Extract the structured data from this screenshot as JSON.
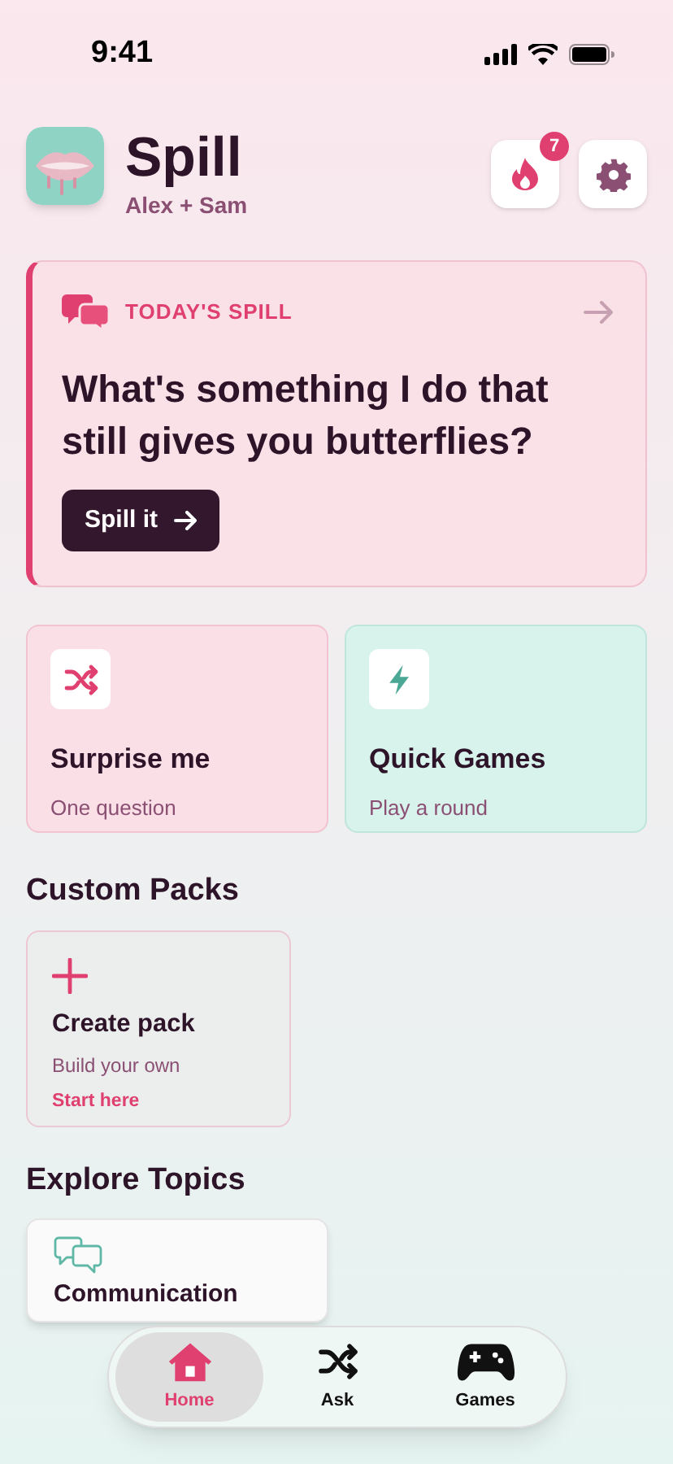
{
  "status_bar": {
    "time": "9:41"
  },
  "header": {
    "title": "Spill",
    "subtitle": "Alex + Sam",
    "streak_count": "7"
  },
  "todays_spill": {
    "label": "TODAY'S SPILL",
    "question": "What's something I do that still gives you butterflies?",
    "button": "Spill it"
  },
  "quick_actions": [
    {
      "kind": "shuffle",
      "title": "Surprise me",
      "subtitle": "One question"
    },
    {
      "kind": "bolt",
      "title": "Quick Games",
      "subtitle": "Play a round"
    }
  ],
  "custom_packs": {
    "heading": "Custom Packs",
    "cards": [
      {
        "title": "Create pack",
        "subtitle": "Build your own",
        "link": "Start here"
      }
    ]
  },
  "explore_topics": {
    "heading": "Explore Topics",
    "topics": [
      {
        "title": "Communication"
      }
    ]
  },
  "tab_bar": [
    {
      "kind": "home",
      "label": "Home",
      "selected": true
    },
    {
      "kind": "shuffle",
      "label": "Ask",
      "selected": false
    },
    {
      "kind": "games",
      "label": "Games",
      "selected": false
    }
  ]
}
